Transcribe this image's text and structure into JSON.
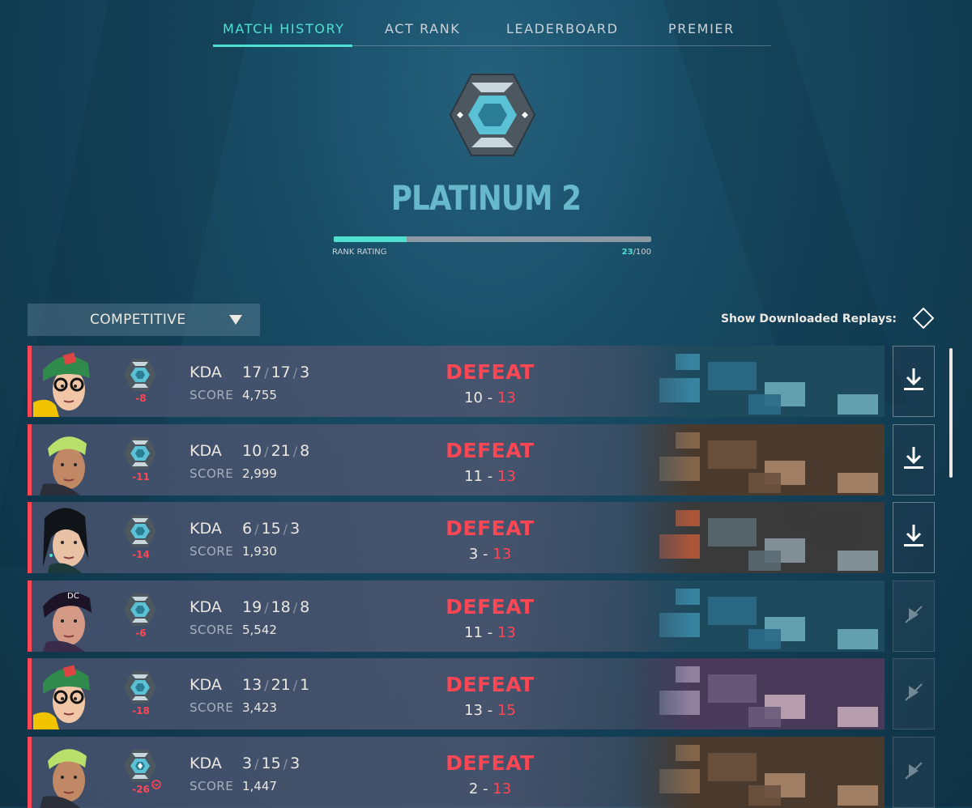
{
  "tabs": [
    {
      "label": "MATCH HISTORY",
      "active": true
    },
    {
      "label": "ACT RANK",
      "active": false
    },
    {
      "label": "LEADERBOARD",
      "active": false
    },
    {
      "label": "PREMIER",
      "active": false
    }
  ],
  "rank": {
    "name": "PLATINUM 2",
    "rating_label": "RANK RATING",
    "rating_current": "23",
    "rating_max": "/100",
    "rating_fraction": 0.23
  },
  "filter": {
    "queue": "COMPETITIVE",
    "replays_label": "Show Downloaded Replays:"
  },
  "colors": {
    "accent": "#4fe0d0",
    "defeat": "#ff4655",
    "rank_teal": "#67b9c9"
  },
  "matches": [
    {
      "agent": "killjoy",
      "rr_change": "-8",
      "kda_label": "KDA",
      "kills": "17",
      "deaths": "17",
      "assists": "3",
      "score_label": "SCORE",
      "score": "4,755",
      "result": "DEFEAT",
      "team_score": "10",
      "dash": "-",
      "enemy_score": "13",
      "map": "blue",
      "replay": "download-icon"
    },
    {
      "agent": "neon-blonde",
      "rr_change": "-11",
      "kda_label": "KDA",
      "kills": "10",
      "deaths": "21",
      "assists": "8",
      "score_label": "SCORE",
      "score": "2,999",
      "result": "DEFEAT",
      "team_score": "11",
      "dash": "-",
      "enemy_score": "13",
      "map": "tan",
      "replay": "download-icon"
    },
    {
      "agent": "sage",
      "rr_change": "-14",
      "kda_label": "KDA",
      "kills": "6",
      "deaths": "15",
      "assists": "3",
      "score_label": "SCORE",
      "score": "1,930",
      "result": "DEFEAT",
      "team_score": "3",
      "dash": "-",
      "enemy_score": "13",
      "map": "red-roofs",
      "replay": "download-icon"
    },
    {
      "agent": "reyna",
      "rr_change": "-6",
      "kda_label": "KDA",
      "kills": "19",
      "deaths": "18",
      "assists": "8",
      "score_label": "SCORE",
      "score": "5,542",
      "result": "DEFEAT",
      "team_score": "11",
      "dash": "-",
      "enemy_score": "13",
      "map": "blue",
      "replay": "unavailable-icon"
    },
    {
      "agent": "killjoy",
      "rr_change": "-18",
      "kda_label": "KDA",
      "kills": "13",
      "deaths": "21",
      "assists": "1",
      "score_label": "SCORE",
      "score": "3,423",
      "result": "DEFEAT",
      "team_score": "13",
      "dash": "-",
      "enemy_score": "15",
      "map": "purple",
      "replay": "unavailable-icon"
    },
    {
      "agent": "neon-blonde",
      "rr_change": "-26",
      "kda_label": "KDA",
      "kills": "3",
      "deaths": "15",
      "assists": "3",
      "score_label": "SCORE",
      "score": "1,447",
      "result": "DEFEAT",
      "team_score": "2",
      "dash": "-",
      "enemy_score": "13",
      "map": "tan",
      "replay": "unavailable-icon",
      "derank": true
    }
  ]
}
